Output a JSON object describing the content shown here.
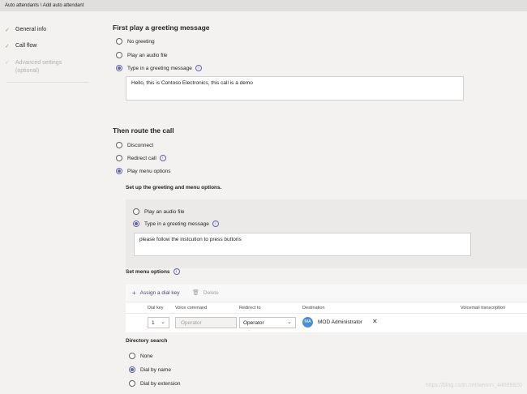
{
  "breadcrumb": "Auto attendants \\ Add auto attendant",
  "sidebar": {
    "steps": [
      {
        "label": "General info",
        "state": "done"
      },
      {
        "label": "Call flow",
        "state": "active"
      },
      {
        "label": "Advanced settings (optional)",
        "state": "inactive"
      }
    ]
  },
  "greeting": {
    "heading": "First play a greeting message",
    "options": [
      "No greeting",
      "Play an audio file",
      "Type in a greeting message"
    ],
    "selected": 2,
    "text": "Hello, this is Contoso Electronics, this call is a demo"
  },
  "route": {
    "heading": "Then route the call",
    "options": [
      "Disconnect",
      "Redirect call",
      "Play menu options"
    ],
    "selected": 2
  },
  "menu_greeting": {
    "heading": "Set up the greeting and menu options.",
    "options": [
      "Play an audio file",
      "Type in a greeting message"
    ],
    "selected": 1,
    "text": "please follow the instcution to press buttons"
  },
  "menu_options": {
    "heading": "Set menu options",
    "assign_label": "Assign a dial key",
    "delete_label": "Delete",
    "columns": [
      "Dial key",
      "Voice command",
      "Redirect to",
      "Destination",
      "Voicemail transcription"
    ],
    "row": {
      "dial_key": "1",
      "voice_command": "Operator",
      "redirect_to": "Operator",
      "avatar_initials": "MA",
      "destination": "MOD Administrator"
    }
  },
  "directory_search": {
    "heading": "Directory search",
    "options": [
      "None",
      "Dial by name",
      "Dial by extension"
    ],
    "selected": 1
  },
  "watermark": "https://blog.csdn.net/weixin_44689820",
  "colors": {
    "accent": "#6264a7",
    "check": "#6bb35d",
    "avatar": "#4a8fd4"
  }
}
